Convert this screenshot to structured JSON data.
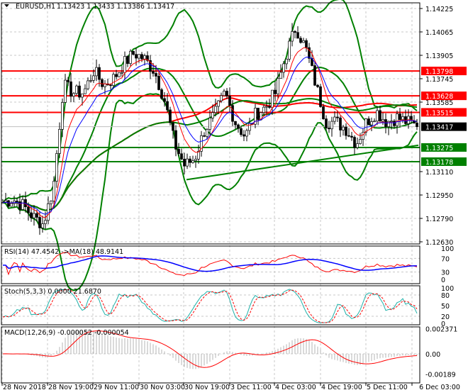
{
  "chart_data": {
    "type": "candlestick",
    "symbol": "EURUSD,H1",
    "ohlc_header": [
      "1.13423",
      "1.13433",
      "1.13386",
      "1.13417"
    ],
    "price_axis_ticks": [
      "1.14225",
      "1.14065",
      "1.13905",
      "1.13745",
      "1.13585",
      "1.13110",
      "1.12950",
      "1.12790",
      "1.12630"
    ],
    "ylim": [
      1.1263,
      1.14225
    ],
    "time_labels": [
      "28 Nov 2018",
      "28 Nov 19:00",
      "29 Nov 11:00",
      "30 Nov 03:00",
      "30 Nov 19:00",
      "3 Dec 11:00",
      "4 Dec 03:00",
      "4 Dec 19:00",
      "5 Dec 11:00",
      "6 Dec 03:00"
    ],
    "close_path": [
      1.129,
      1.1292,
      1.1288,
      1.128,
      1.1275,
      1.13,
      1.137,
      1.1365,
      1.1365,
      1.138,
      1.137,
      1.1375,
      1.1385,
      1.1392,
      1.1388,
      1.138,
      1.136,
      1.133,
      1.1315,
      1.132,
      1.134,
      1.135,
      1.1365,
      1.1345,
      1.1335,
      1.135,
      1.1355,
      1.1365,
      1.139,
      1.141,
      1.1395,
      1.137,
      1.1345,
      1.1345,
      1.134,
      1.133,
      1.1345,
      1.1352,
      1.1345,
      1.1348,
      1.1345,
      1.1342
    ],
    "levels": [
      {
        "price": "1.13798",
        "color": "#ff0000"
      },
      {
        "price": "1.13628",
        "color": "#ff0000"
      },
      {
        "price": "1.13515",
        "color": "#ff0000"
      },
      {
        "price": "1.13275",
        "color": "#008000"
      },
      {
        "price": "1.13178",
        "color": "#008000"
      }
    ],
    "current_price": "1.13417",
    "trendline": [
      1.13055,
      1.1329
    ],
    "rsi": {
      "label": "RSI(14) 47.4542  ->MA(18) 48.9141",
      "ticks": [
        "100",
        "70",
        "30",
        "0"
      ]
    },
    "stoch": {
      "label": "Stoch(5,3,3) 0.0000 21.6870",
      "ticks": [
        "100",
        "80",
        "50",
        "20",
        "0"
      ]
    },
    "macd": {
      "label": "MACD(12,26,9) -0.000052 -0.000054",
      "ticks": [
        "0.002371",
        "0.00",
        "-0.00189"
      ]
    }
  }
}
